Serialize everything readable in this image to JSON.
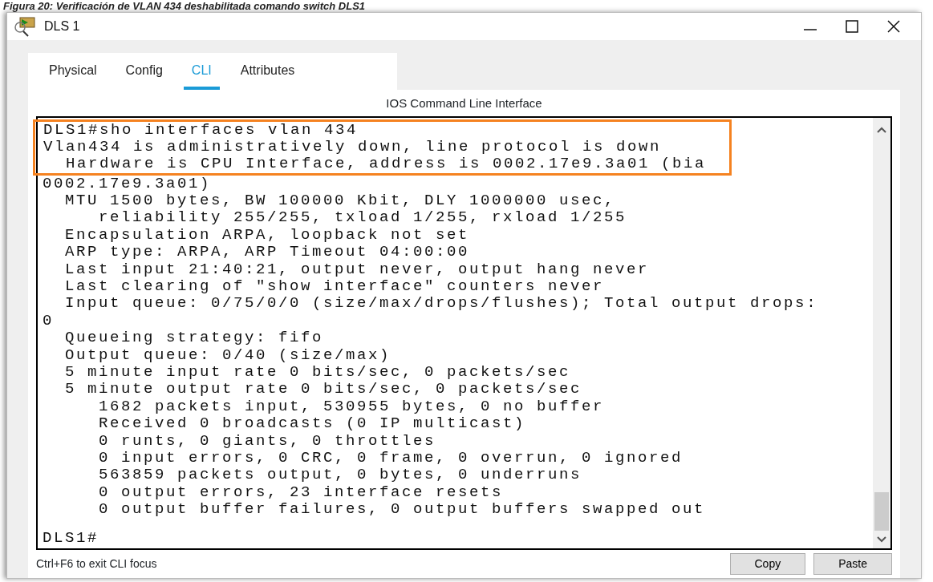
{
  "caption": "Figura 20: Verificación de VLAN 434 deshabilitada comando switch DLS1",
  "window": {
    "title": "DLS 1"
  },
  "tabs": [
    {
      "label": "Physical",
      "selected": false
    },
    {
      "label": "Config",
      "selected": false
    },
    {
      "label": "CLI",
      "selected": true
    },
    {
      "label": "Attributes",
      "selected": false
    }
  ],
  "panel_title": "IOS Command Line Interface",
  "terminal": {
    "lines": [
      {
        "text": "DLS1#sho interfaces vlan 434",
        "highlighted": true
      },
      {
        "text": "Vlan434 is administratively down, line protocol is down",
        "highlighted": true
      },
      {
        "text": "  Hardware is CPU Interface, address is 0002.17e9.3a01 (bia",
        "highlighted": true
      },
      {
        "text": "0002.17e9.3a01)",
        "highlighted": false
      },
      {
        "text": "  MTU 1500 bytes, BW 100000 Kbit, DLY 1000000 usec,",
        "highlighted": false
      },
      {
        "text": "     reliability 255/255, txload 1/255, rxload 1/255",
        "highlighted": false
      },
      {
        "text": "  Encapsulation ARPA, loopback not set",
        "highlighted": false
      },
      {
        "text": "  ARP type: ARPA, ARP Timeout 04:00:00",
        "highlighted": false
      },
      {
        "text": "  Last input 21:40:21, output never, output hang never",
        "highlighted": false
      },
      {
        "text": "  Last clearing of \"show interface\" counters never",
        "highlighted": false
      },
      {
        "text": "  Input queue: 0/75/0/0 (size/max/drops/flushes); Total output drops:",
        "highlighted": false
      },
      {
        "text": "0",
        "highlighted": false
      },
      {
        "text": "  Queueing strategy: fifo",
        "highlighted": false
      },
      {
        "text": "  Output queue: 0/40 (size/max)",
        "highlighted": false
      },
      {
        "text": "  5 minute input rate 0 bits/sec, 0 packets/sec",
        "highlighted": false
      },
      {
        "text": "  5 minute output rate 0 bits/sec, 0 packets/sec",
        "highlighted": false
      },
      {
        "text": "     1682 packets input, 530955 bytes, 0 no buffer",
        "highlighted": false
      },
      {
        "text": "     Received 0 broadcasts (0 IP multicast)",
        "highlighted": false
      },
      {
        "text": "     0 runts, 0 giants, 0 throttles",
        "highlighted": false
      },
      {
        "text": "     0 input errors, 0 CRC, 0 frame, 0 overrun, 0 ignored",
        "highlighted": false
      },
      {
        "text": "     563859 packets output, 0 bytes, 0 underruns",
        "highlighted": false
      },
      {
        "text": "     0 output errors, 23 interface resets",
        "highlighted": false
      },
      {
        "text": "     0 output buffer failures, 0 output buffers swapped out",
        "highlighted": false
      }
    ],
    "prompt": "DLS1#"
  },
  "footer": {
    "hint": "Ctrl+F6 to exit CLI focus",
    "buttons": [
      "Copy",
      "Paste"
    ]
  }
}
